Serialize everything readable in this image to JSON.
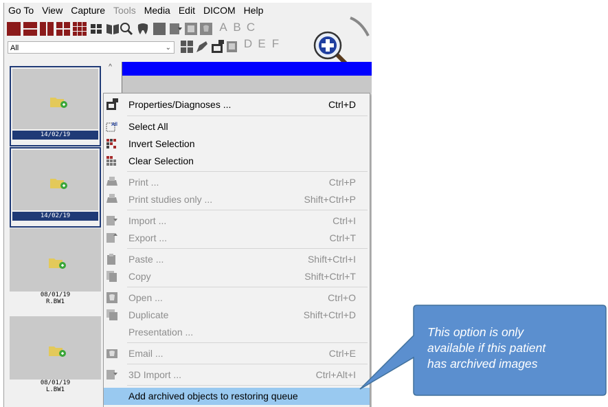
{
  "menubar": {
    "items": [
      {
        "label": "Go To",
        "disabled": false
      },
      {
        "label": "View",
        "disabled": false
      },
      {
        "label": "Capture",
        "disabled": false
      },
      {
        "label": "Tools",
        "disabled": true
      },
      {
        "label": "Media",
        "disabled": false
      },
      {
        "label": "Edit",
        "disabled": false
      },
      {
        "label": "DICOM",
        "disabled": false
      },
      {
        "label": "Help",
        "disabled": false
      }
    ]
  },
  "toolbar": {
    "row1_letters": [
      "A",
      "B",
      "C"
    ],
    "row2_letters": [
      "D",
      "E",
      "F"
    ],
    "filter_select": "All",
    "icons_row1": [
      "layout-1-icon",
      "layout-2-icon",
      "layout-3-icon",
      "layout-4-icon",
      "layout-grid-icon",
      "layout-quad-icon",
      "book-icon",
      "zoom-icon",
      "tooth-icon",
      "square-icon",
      "tooth-import-icon",
      "tooth-frame-icon",
      "tooth-export-icon"
    ],
    "icons_row2": [
      "grid-icon",
      "pen-icon",
      "tooth-properties-icon",
      "tooth-copy-icon"
    ]
  },
  "thumbnails": [
    {
      "date": "14/02/19",
      "label": "",
      "selected": true
    },
    {
      "date": "14/02/19",
      "label": "",
      "selected": true
    },
    {
      "date": "08/01/19",
      "label": "R.BW1",
      "selected": false
    },
    {
      "date": "08/01/19",
      "label": "L.BW1",
      "selected": false
    }
  ],
  "context_menu": {
    "items": [
      {
        "label": "Properties/Diagnoses ...",
        "shortcut": "Ctrl+D",
        "disabled": false,
        "icon": "tooth-properties-icon"
      },
      {
        "label": "Select All",
        "shortcut": "",
        "disabled": false,
        "icon": "select-all-icon"
      },
      {
        "label": "Invert Selection",
        "shortcut": "",
        "disabled": false,
        "icon": "invert-selection-icon"
      },
      {
        "label": "Clear Selection",
        "shortcut": "",
        "disabled": false,
        "icon": "clear-selection-icon"
      },
      {
        "label": "Print ...",
        "shortcut": "Ctrl+P",
        "disabled": true,
        "icon": "print-icon"
      },
      {
        "label": "Print studies only ...",
        "shortcut": "Shift+Ctrl+P",
        "disabled": true,
        "icon": "print-studies-icon"
      },
      {
        "label": "Import ...",
        "shortcut": "Ctrl+I",
        "disabled": true,
        "icon": "import-icon"
      },
      {
        "label": "Export ...",
        "shortcut": "Ctrl+T",
        "disabled": true,
        "icon": "export-icon"
      },
      {
        "label": "Paste ...",
        "shortcut": "Shift+Ctrl+I",
        "disabled": true,
        "icon": "paste-icon"
      },
      {
        "label": "Copy",
        "shortcut": "Shift+Ctrl+T",
        "disabled": true,
        "icon": "copy-icon"
      },
      {
        "label": "Open ...",
        "shortcut": "Ctrl+O",
        "disabled": true,
        "icon": "open-icon"
      },
      {
        "label": "Duplicate",
        "shortcut": "Shift+Ctrl+D",
        "disabled": true,
        "icon": "duplicate-icon"
      },
      {
        "label": "Presentation ...",
        "shortcut": "",
        "disabled": true,
        "icon": ""
      },
      {
        "label": "Email ...",
        "shortcut": "Ctrl+E",
        "disabled": true,
        "icon": "email-icon"
      },
      {
        "label": "3D Import ...",
        "shortcut": "Ctrl+Alt+I",
        "disabled": true,
        "icon": "3d-import-icon"
      },
      {
        "label": "Add archived objects to restoring queue",
        "shortcut": "",
        "disabled": false,
        "highlighted": true,
        "icon": ""
      }
    ]
  },
  "callout": {
    "lines": [
      "This option is only",
      "available if this patient",
      "has archived images"
    ],
    "fill": "#5b8fcf",
    "stroke": "#41719c"
  },
  "colors": {
    "selection_dark": "#1f3a76",
    "header_blue": "#0000ff",
    "highlight": "#99c9f0"
  }
}
